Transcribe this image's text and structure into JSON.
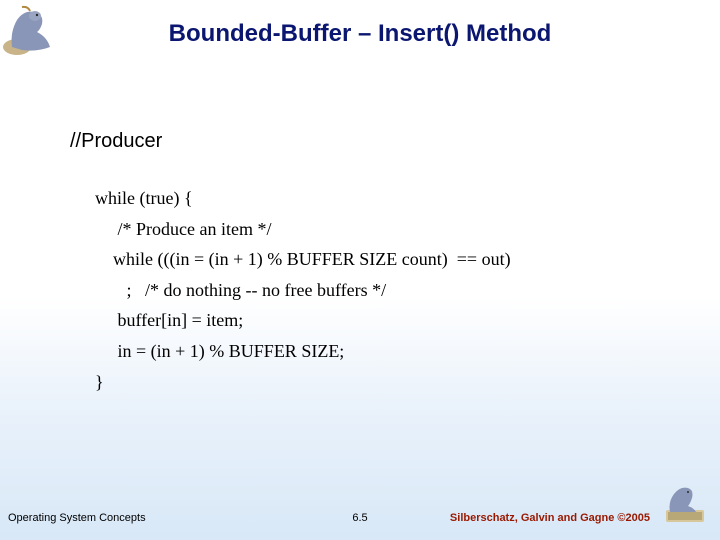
{
  "title": "Bounded-Buffer – Insert() Method",
  "section": "//Producer",
  "code": {
    "l1": "while (true) {",
    "l2": "     /* Produce an item */",
    "l3": "    while (((in = (in + 1) % BUFFER SIZE count)  == out)",
    "l4": "       ;   /* do nothing -- no free buffers */",
    "l5": "     buffer[in] = item;",
    "l6": "     in = (in + 1) % BUFFER SIZE;",
    "l7": "}"
  },
  "footer": {
    "left": "Operating System Concepts",
    "center": "6.5",
    "right": "Silberschatz, Galvin and Gagne ©2005"
  }
}
